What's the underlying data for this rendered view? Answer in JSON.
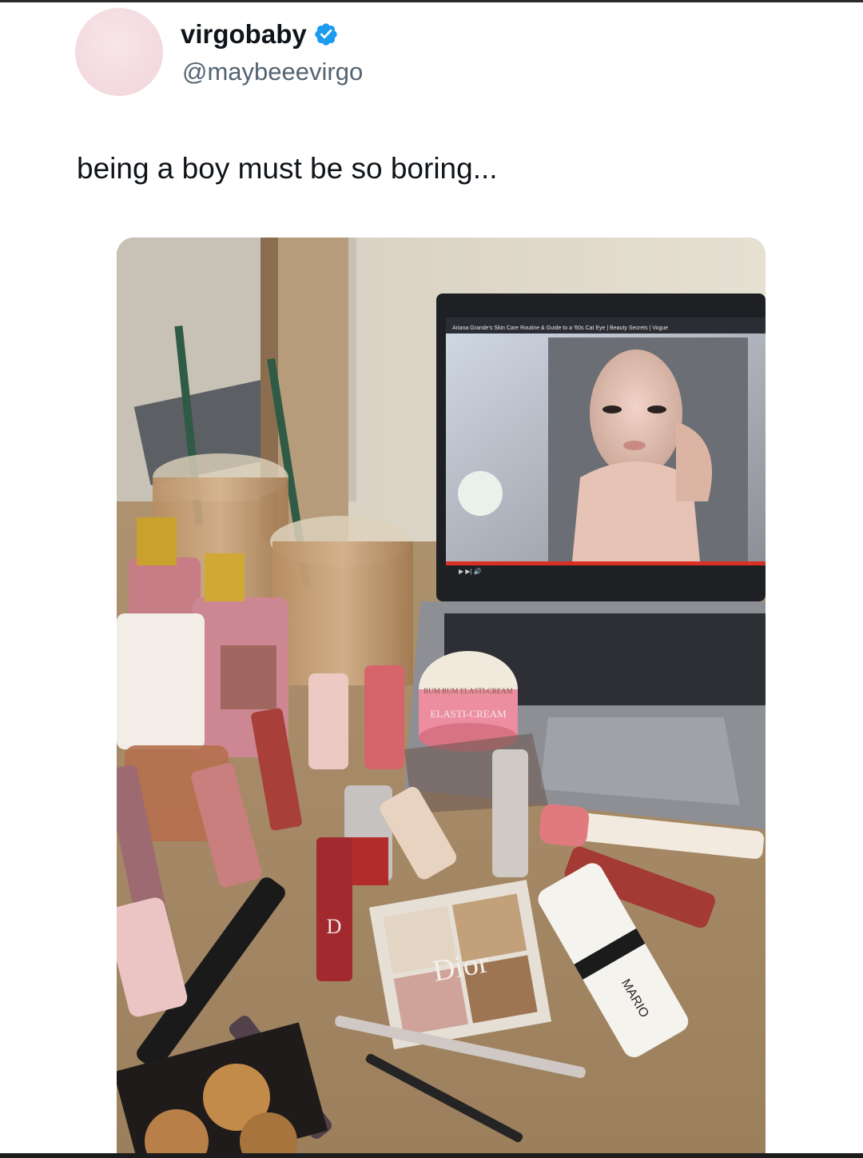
{
  "tweet": {
    "display_name": "virgobaby",
    "handle": "@maybeeevirgo",
    "text": "being a boy must be so boring..."
  },
  "photo": {
    "video_title": "Ariana Grande's Skin Care Routine & Guide to a '60s Cat Eye | Beauty Secrets | Vogue",
    "products": {
      "palette_brand": "Dior",
      "cream_label": "ELASTI-CREAM",
      "cream_label_top": "BUM BUM ELASTI-CREAM",
      "stick_brand": "MARIO",
      "lipgloss_mark": "D"
    }
  },
  "colors": {
    "verified_blue": "#1d9bf0",
    "name": "#0f1419",
    "handle": "#536471"
  },
  "icons": [
    "verified-badge-icon"
  ]
}
